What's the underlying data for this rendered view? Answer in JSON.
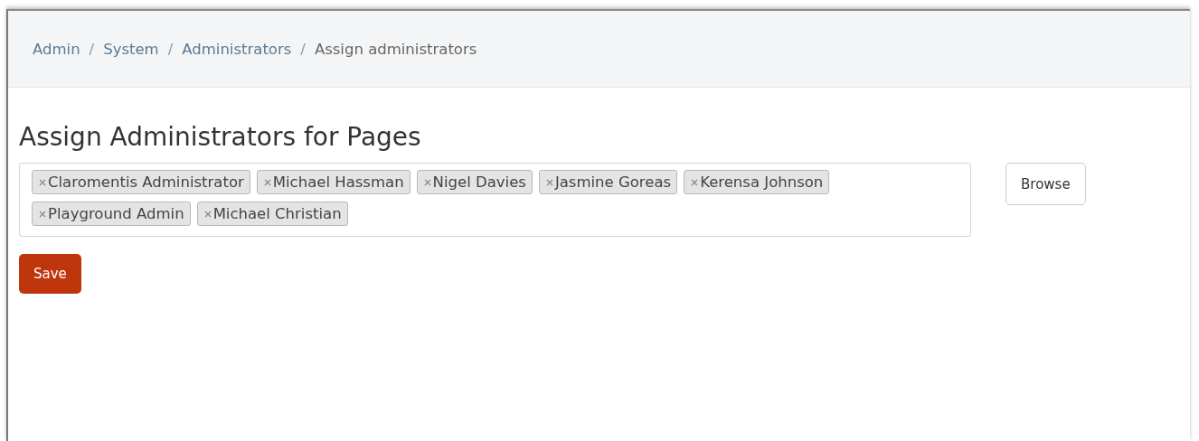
{
  "breadcrumb": [
    {
      "label": "Admin",
      "link": true
    },
    {
      "separator": "/",
      "label": "System",
      "link": true
    },
    {
      "separator": "/",
      "label": "Administrators",
      "link": true
    },
    {
      "separator": "/",
      "label": "Assign administrators",
      "link": false
    }
  ],
  "heading": "Assign Administrators for Pages",
  "assigned": [
    {
      "name": "Claromentis Administrator"
    },
    {
      "name": "Michael Hassman"
    },
    {
      "name": "Nigel Davies"
    },
    {
      "name": "Jasmine Goreas"
    },
    {
      "name": "Kerensa Johnson"
    },
    {
      "name": "Playground Admin"
    },
    {
      "name": "Michael Christian"
    }
  ],
  "browse_button": "Browse",
  "save_button": "Save"
}
